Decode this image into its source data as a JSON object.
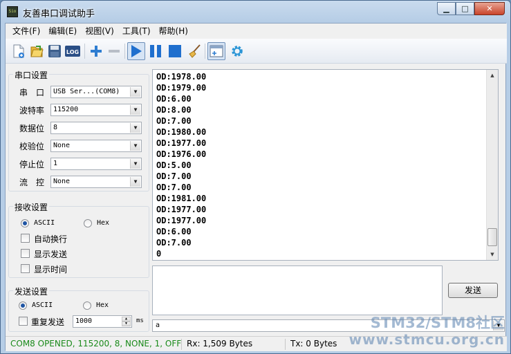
{
  "window": {
    "title": "友善串口调试助手",
    "icon_text": "Sio",
    "minimize_glyph": "▁",
    "maximize_glyph": "□",
    "close_glyph": "✕"
  },
  "menu": [
    "文件(F)",
    "编辑(E)",
    "视图(V)",
    "工具(T)",
    "帮助(H)"
  ],
  "toolbar": {
    "log_label": "LOG",
    "icons": [
      "new-file-icon",
      "open-icon",
      "save-icon",
      "log-icon",
      "add-icon",
      "remove-icon",
      "play-icon",
      "pause-icon",
      "stop-icon",
      "broom-icon",
      "new-window-icon",
      "settings-icon"
    ]
  },
  "serial_settings": {
    "title": "串口设置",
    "port": {
      "label": "串　口",
      "value": "USB Ser...(COM8)"
    },
    "baud": {
      "label": "波特率",
      "value": "115200"
    },
    "data_bits": {
      "label": "数据位",
      "value": "8"
    },
    "parity": {
      "label": "校验位",
      "value": "None"
    },
    "stop_bits": {
      "label": "停止位",
      "value": "1"
    },
    "flow": {
      "label": "流　控",
      "value": "None"
    }
  },
  "receive_settings": {
    "title": "接收设置",
    "ascii": "ASCII",
    "hex": "Hex",
    "auto_wrap": "自动换行",
    "show_send": "显示发送",
    "show_time": "显示时间"
  },
  "send_settings": {
    "title": "发送设置",
    "ascii": "ASCII",
    "hex": "Hex",
    "repeat": "重复发送",
    "interval": "1000",
    "unit": "ms"
  },
  "receive_lines": [
    "OD:1978.00",
    "OD:1979.00",
    "OD:6.00",
    "OD:8.00",
    "OD:7.00",
    "OD:1980.00",
    "OD:1977.00",
    "OD:1976.00",
    "OD:5.00",
    "OD:7.00",
    "OD:7.00",
    "OD:1981.00",
    "OD:1977.00",
    "OD:1977.00",
    "OD:6.00",
    "OD:7.00",
    "0"
  ],
  "send_button": "发送",
  "history_value": "a",
  "status": {
    "port_state": "COM8 OPENED, 115200, 8, NONE, 1, OFF",
    "rx": "Rx: 1,509 Bytes",
    "tx": "Tx: 0 Bytes",
    "port_color": "#1a8a1a"
  },
  "watermark": {
    "line1": "STM32/STM8社区",
    "line2": "www.stmcu.org.cn"
  }
}
